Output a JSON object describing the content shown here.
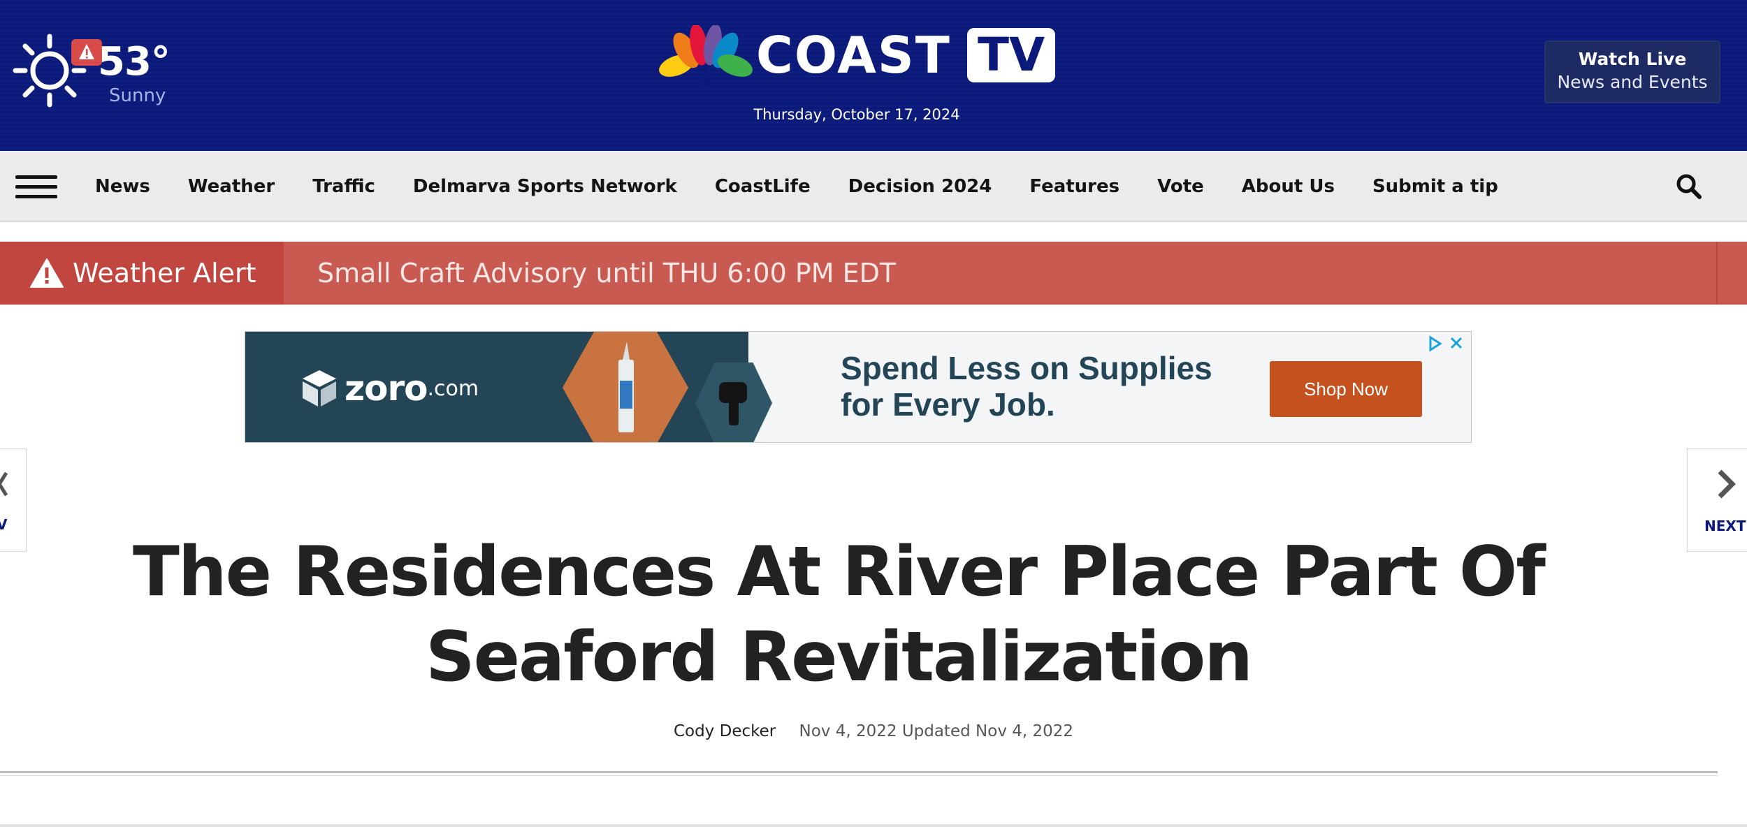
{
  "header": {
    "weather": {
      "temperature": "53°",
      "condition": "Sunny",
      "icon": "sun-icon",
      "alert_icon": "warning-icon"
    },
    "brand": {
      "name_main": "COAST",
      "name_badge": "TV",
      "logo_icon": "peacock-logo"
    },
    "date": "Thursday, October 17, 2024",
    "watch_live": {
      "title": "Watch Live",
      "subtitle": "News and Events"
    }
  },
  "nav": {
    "items": [
      "News",
      "Weather",
      "Traffic",
      "Delmarva Sports Network",
      "CoastLife",
      "Decision 2024",
      "Features",
      "Vote",
      "About Us",
      "Submit a tip"
    ],
    "menu_icon": "hamburger-icon",
    "search_icon": "search-icon"
  },
  "alert": {
    "label": "Weather Alert",
    "message": "Small Craft Advisory until THU 6:00 PM EDT"
  },
  "ad": {
    "brand": "zoro",
    "brand_suffix": ".com",
    "headline_line1": "Spend Less on Supplies",
    "headline_line2": "for Every Job.",
    "cta": "Shop Now"
  },
  "pager": {
    "prev_label": "V",
    "next_label": "NEXT"
  },
  "article": {
    "title": "The Residences At River Place Part Of Seaford Revitalization",
    "author": "Cody Decker",
    "dates": "Nov 4, 2022 Updated Nov 4, 2022"
  },
  "colors": {
    "header_bg": "#0b1a7a",
    "nav_bg": "#ebebeb",
    "alert_bg": "#c95a52",
    "alert_label_bg": "#c0463f",
    "ad_dark": "#234556",
    "ad_cta": "#c4511e"
  }
}
